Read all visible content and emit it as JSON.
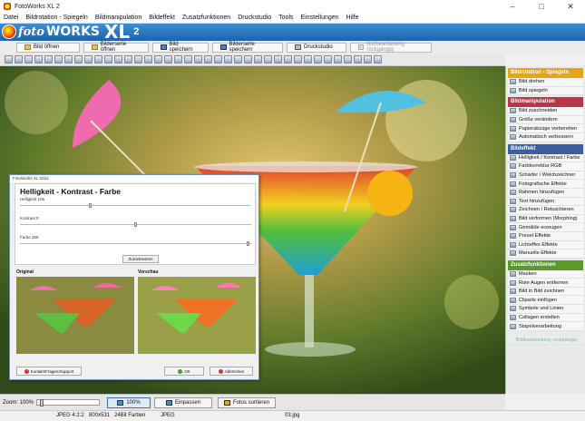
{
  "window": {
    "title": "FotoWorks XL 2"
  },
  "menu": [
    "Datei",
    "Bildrotation - Spiegeln",
    "Bildmanipulation",
    "Bildeffekt",
    "Zusatzfunktionen",
    "Druckstudio",
    "Tools",
    "Einstellungen",
    "Hilfe"
  ],
  "brand": {
    "foto": "foto",
    "works": "WORKS",
    "xl": "XL",
    "version": "2"
  },
  "toolbar": {
    "buttons": [
      {
        "label": "Bild öffnen"
      },
      {
        "label": "Bilderserie öffnen"
      },
      {
        "label": "Bild speichern"
      },
      {
        "label": "Bilderserie speichern"
      },
      {
        "label": "Druckstudio"
      },
      {
        "label": "Bildbearbeitung rückgängig"
      }
    ]
  },
  "sidebar": {
    "sections": [
      {
        "title": "Bildrotation - Spiegeln",
        "color": "#e8a31a",
        "items": [
          "Bild drehen",
          "Bild spiegeln"
        ]
      },
      {
        "title": "Bildmanipulation",
        "color": "#b8364a",
        "items": [
          "Bild zuschneiden",
          "Größe verändern",
          "Papierabzüge vorbereiten",
          "Automatisch verbessern"
        ]
      },
      {
        "title": "Bildeffekt",
        "color": "#3a5f9e",
        "items": [
          "Helligkeit / Kontrast / Farbe",
          "Farbkorrektur RGB",
          "Schärfer / Weichzeichner",
          "Fotografische Effekte",
          "Rahmen hinzufügen",
          "Text hinzufügen",
          "Zeichnen / Retuschieren",
          "Bild verformen (Morphing)",
          "Gemälde erzeugen",
          "Preset Effekte",
          "Lichteffex Effekte",
          "Manuelle Effekte"
        ]
      },
      {
        "title": "Zusatzfunktionen",
        "color": "#5a9a2a",
        "items": [
          "Masken",
          "Rote Augen entfernen",
          "Bild in Bild zeichnen",
          "Cliparts einfügen",
          "Symbole und Linien",
          "Collagen erstellen",
          "Stapelverarbeitung"
        ]
      }
    ],
    "undo_label": "Bildbearbeitung rückgängig"
  },
  "bottom": {
    "zoom_label": "Zoom: 100%",
    "zoom_button": "100%",
    "fit_button": "Einpassen",
    "sort_button": "Fotos sortieren"
  },
  "status": {
    "format": "JPEG 4:2:2",
    "dims": "800x531",
    "bits": "24Bit Farben",
    "type": "JPEG",
    "file": "03.jpg"
  },
  "dialog": {
    "title": "FotoWorks XL 2022",
    "heading": "Helligkeit - Kontrast - Farbe",
    "sliders": [
      {
        "label": "Helligkeit 106",
        "value": 106
      },
      {
        "label": "Kontrast 0",
        "value": 0
      },
      {
        "label": "Farbe 256",
        "value": 256
      }
    ],
    "reset_label": "Zurücksetzen",
    "original_label": "Original",
    "preview_label": "Vorschau",
    "support_label": "Kontakt/Fragen/Support",
    "ok_label": "OK",
    "cancel_label": "Abbrechen"
  }
}
